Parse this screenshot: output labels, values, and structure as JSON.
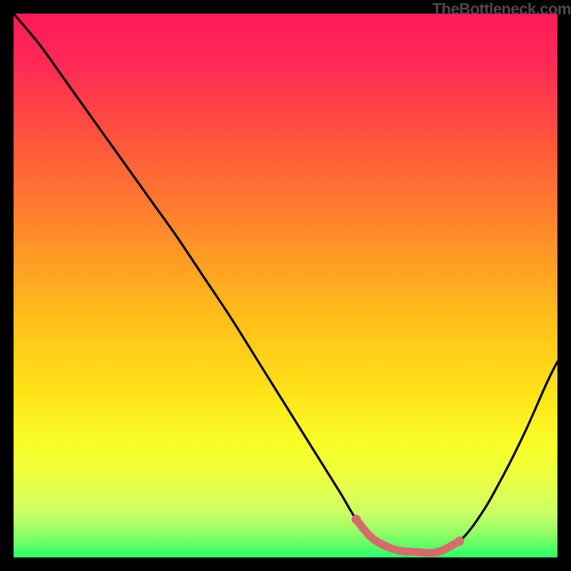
{
  "watermark": "TheBottleneck.com",
  "chart_data": {
    "type": "line",
    "title": "",
    "xlabel": "",
    "ylabel": "",
    "xlim": [
      0,
      100
    ],
    "ylim": [
      0,
      100
    ],
    "grid": false,
    "legend": false,
    "series": [
      {
        "name": "bottleneck-curve",
        "x": [
          0,
          5,
          10,
          15,
          20,
          25,
          30,
          35,
          40,
          45,
          50,
          55,
          60,
          63,
          66,
          70,
          74,
          78,
          82,
          86,
          90,
          94,
          98,
          100
        ],
        "values": [
          100,
          94,
          87,
          80,
          73,
          66,
          59,
          51.5,
          44,
          36,
          28,
          20,
          12,
          7,
          3.5,
          1.5,
          1,
          1,
          3,
          8,
          15,
          23,
          32,
          36
        ]
      },
      {
        "name": "highlight-band",
        "x": [
          63,
          66,
          70,
          74,
          78,
          82
        ],
        "values": [
          7,
          3.5,
          1.5,
          1,
          1,
          3
        ]
      }
    ],
    "gradient_stops": [
      {
        "offset": 0.0,
        "color": "#ff1a5a"
      },
      {
        "offset": 0.1,
        "color": "#ff2b53"
      },
      {
        "offset": 0.25,
        "color": "#ff5a3a"
      },
      {
        "offset": 0.4,
        "color": "#ff8a2a"
      },
      {
        "offset": 0.55,
        "color": "#ffbc1a"
      },
      {
        "offset": 0.7,
        "color": "#ffe418"
      },
      {
        "offset": 0.8,
        "color": "#f8ff2a"
      },
      {
        "offset": 0.87,
        "color": "#e6ff4a"
      },
      {
        "offset": 0.92,
        "color": "#c8ff66"
      },
      {
        "offset": 0.96,
        "color": "#8aff66"
      },
      {
        "offset": 1.0,
        "color": "#2aff6a"
      }
    ],
    "highlight_color": "#d86a6a"
  }
}
